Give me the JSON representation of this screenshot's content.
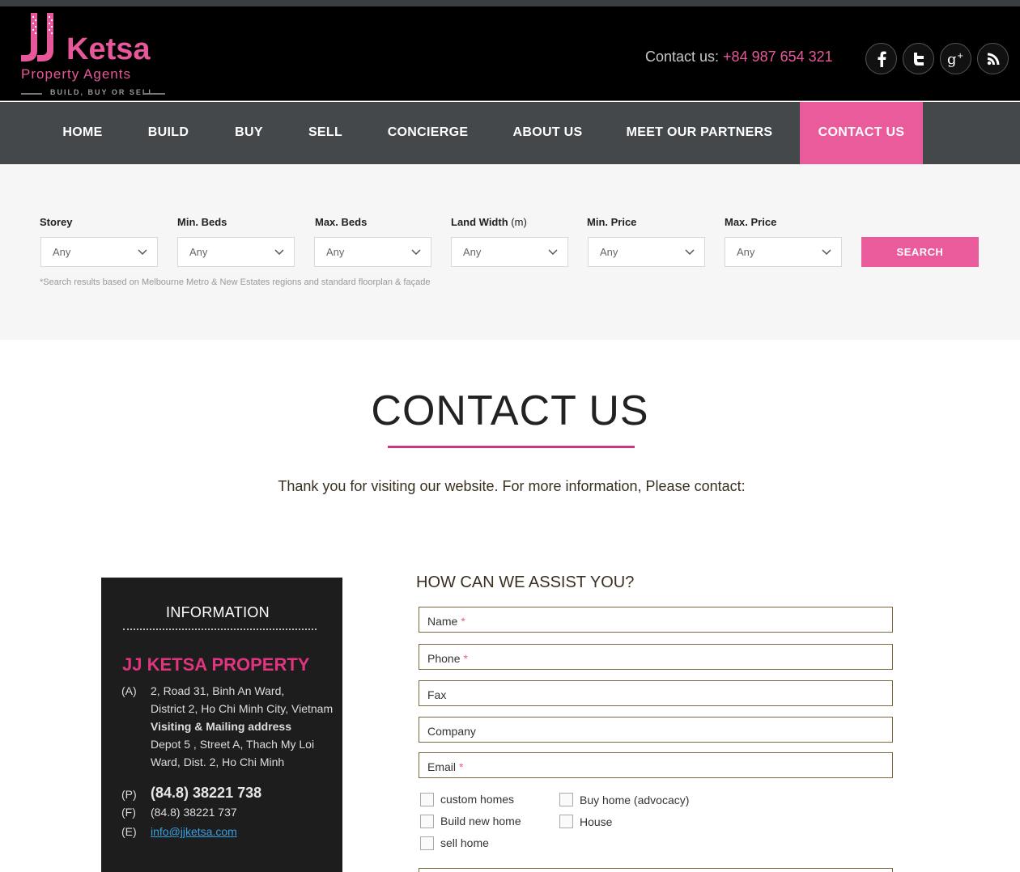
{
  "header": {
    "logo": {
      "brand_name": "Ketsa",
      "subtitle": "Property Agents",
      "tagline": "BUILD, BUY OR SELL"
    },
    "contact_prefix": "Contact us: ",
    "contact_phone": "+84 987 654 321",
    "social_icons": [
      "facebook-icon",
      "twitter-icon",
      "google-plus-icon",
      "rss-icon"
    ]
  },
  "nav": {
    "items": [
      {
        "label": "HOME"
      },
      {
        "label": "BUILD"
      },
      {
        "label": "BUY"
      },
      {
        "label": "SELL"
      },
      {
        "label": "CONCIERGE"
      },
      {
        "label": "ABOUT US"
      },
      {
        "label": "MEET OUR PARTNERS"
      },
      {
        "label": "CONTACT US",
        "active": true
      }
    ]
  },
  "search": {
    "filters": [
      {
        "label": "Storey",
        "value": "Any"
      },
      {
        "label": "Min. Beds",
        "value": "Any"
      },
      {
        "label": "Max. Beds",
        "value": "Any"
      },
      {
        "label": "Land Width",
        "unit": "(m)",
        "value": "Any"
      },
      {
        "label": "Min. Price",
        "value": "Any"
      },
      {
        "label": "Max. Price",
        "value": "Any"
      }
    ],
    "button_label": "SEARCH",
    "note": "*Search results based on Melbourne Metro & New Estates regions and standard floorplan & façade"
  },
  "main": {
    "title": "CONTACT US",
    "intro": "Thank you for visiting our website. For more information, Please contact:"
  },
  "info": {
    "heading": "INFORMATION",
    "company": "JJ KETSA PROPERTY",
    "address_key": "(A)",
    "address_line1": "2, Road 31, Binh An Ward,",
    "address_line2": "District 2, Ho Chi Minh City, Vietnam",
    "mailing_heading": "Visiting & Mailing address",
    "mailing_line1": "Depot 5 , Street A, Thach My Loi",
    "mailing_line2": "Ward, Dist. 2, Ho Chi Minh",
    "phone_key": "(P)",
    "phone": "(84.8) 38221 738",
    "fax_key": "(F)",
    "fax": "(84.8) 38221 737",
    "email_key": "(E)",
    "email": "info@jjketsa.com"
  },
  "form": {
    "heading": "HOW CAN WE ASSIST YOU?",
    "fields": [
      {
        "placeholder": "Name",
        "required_mark": "*"
      },
      {
        "placeholder": "Phone",
        "required_mark": "*"
      },
      {
        "placeholder": "Fax",
        "required_mark": ""
      },
      {
        "placeholder": "Company",
        "required_mark": ""
      },
      {
        "placeholder": "Email",
        "required_mark": "*"
      }
    ],
    "checkboxes": [
      {
        "label": "custom homes",
        "checked": false
      },
      {
        "label": "Build new home",
        "checked": false
      },
      {
        "label": "sell home",
        "checked": false
      },
      {
        "label": "Buy home (advocacy)",
        "checked": false
      },
      {
        "label": "House",
        "checked": false
      }
    ]
  },
  "colors": {
    "accent_pink": "#e95b9b",
    "title_pink": "#e0357e",
    "nav_bg": "#44484b",
    "header_bg": "#000000"
  }
}
